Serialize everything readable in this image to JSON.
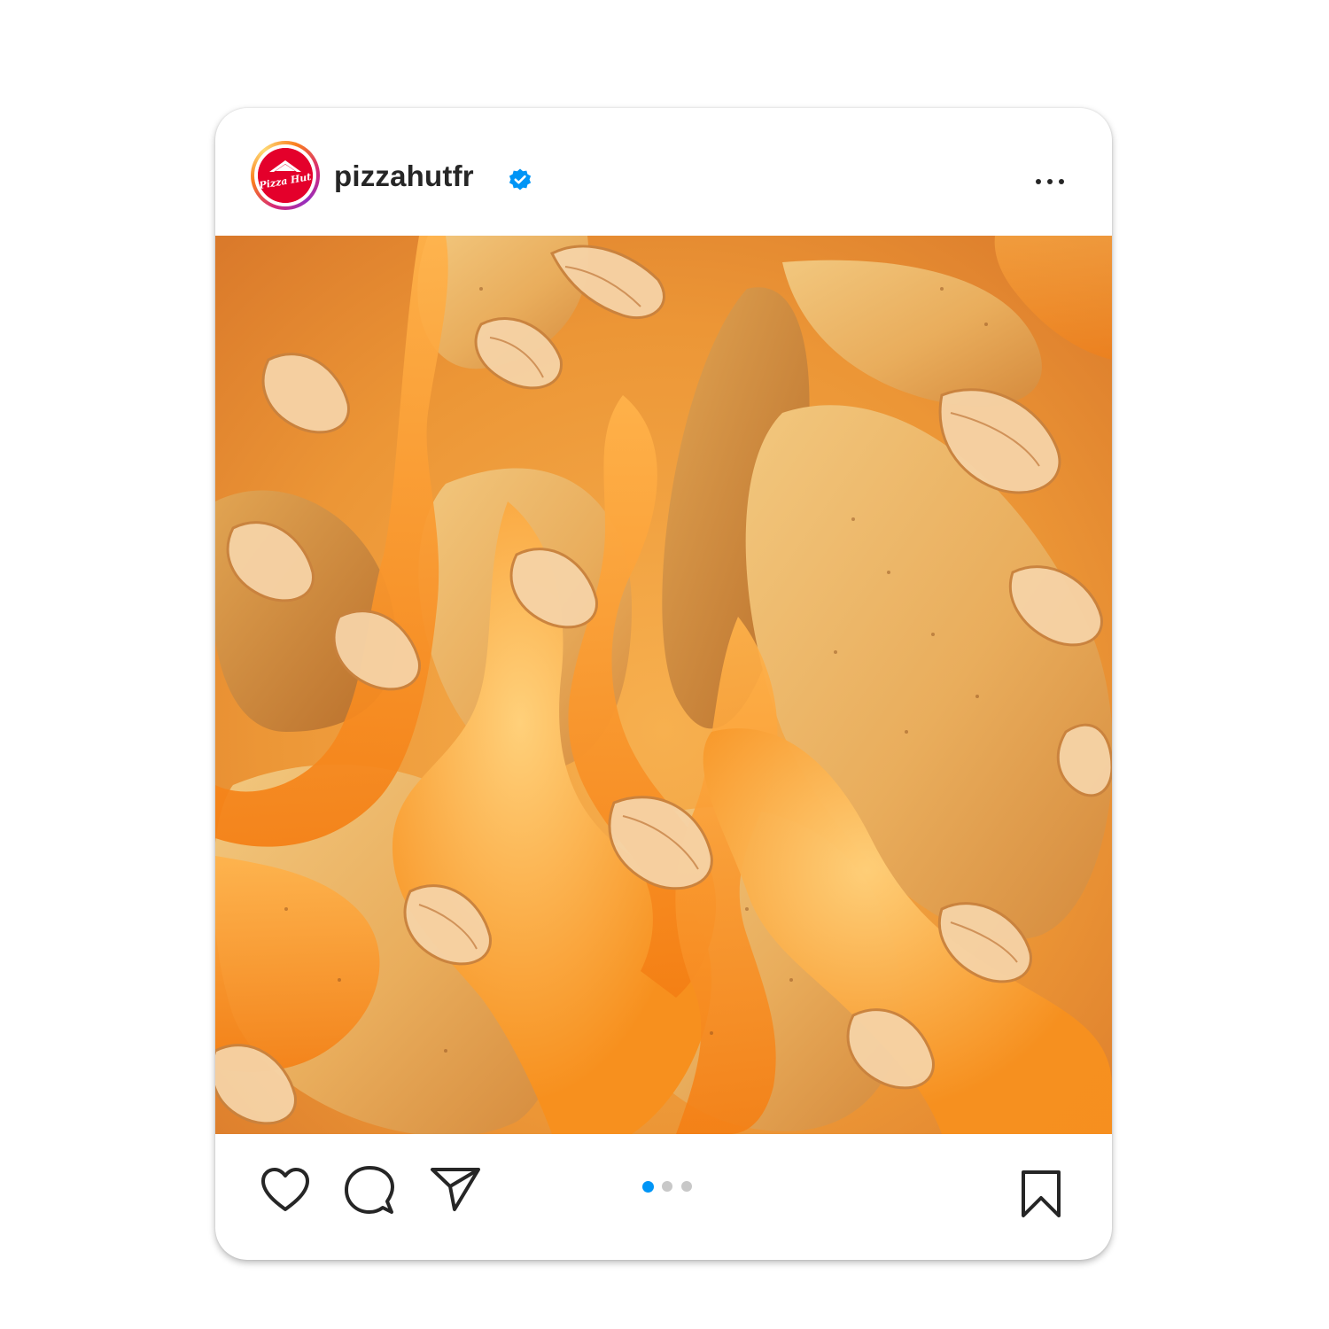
{
  "post": {
    "username": "pizzahutfr",
    "verified": true,
    "avatar_brand_text": "Pizza Hut",
    "avatar_icon": "pizza-hut-logo",
    "more_icon": "more-options-icon",
    "image_description_icon": "food-photo-image",
    "carousel": {
      "current": 1,
      "total": 3
    },
    "actions": {
      "like_icon": "heart-icon",
      "comment_icon": "comment-bubble-icon",
      "share_icon": "paper-plane-icon",
      "save_icon": "bookmark-icon"
    }
  },
  "colors": {
    "brand_red": "#e4002b",
    "verified_blue": "#0095f6",
    "active_dot": "#0095f6",
    "inactive_dot": "#c8c8c8",
    "text": "#262626"
  }
}
